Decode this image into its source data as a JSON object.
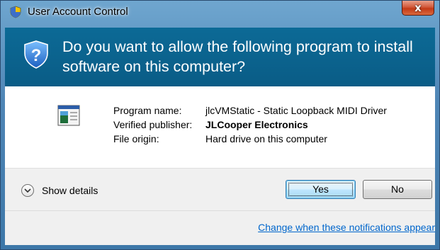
{
  "window": {
    "title": "User Account Control",
    "close_glyph": "x"
  },
  "banner": {
    "question": "Do you want to allow the following program to install software on this computer?",
    "icon": "shield-question-icon"
  },
  "program": {
    "icon": "program-window-icon",
    "rows": [
      {
        "label": "Program name:",
        "value": "jlcVMStatic - Static Loopback MIDI Driver"
      },
      {
        "label": "Verified publisher:",
        "value": "JLCooper Electronics"
      },
      {
        "label": "File origin:",
        "value": "Hard drive on this computer"
      }
    ]
  },
  "footer": {
    "details_label": "Show details",
    "yes_label": "Yes",
    "no_label": "No",
    "settings_link": "Change when these notifications appear"
  },
  "colors": {
    "banner": "#0a5c86",
    "link": "#0066cc",
    "frame": "#4f86b6"
  }
}
